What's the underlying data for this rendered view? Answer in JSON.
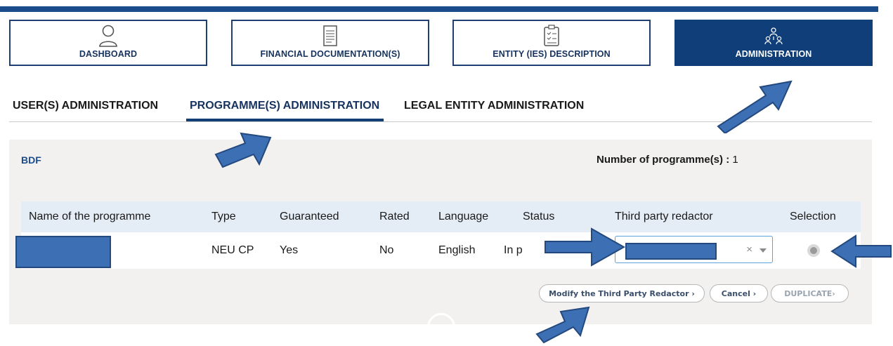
{
  "nav": {
    "cards": [
      {
        "label": "DASHBOARD",
        "icon": "user-icon"
      },
      {
        "label": "FINANCIAL DOCUMENTATION(S)",
        "icon": "document-icon"
      },
      {
        "label": "ENTITY (IES) DESCRIPTION",
        "icon": "clipboard-icon"
      },
      {
        "label": "ADMINISTRATION",
        "icon": "org-chart-icon"
      }
    ],
    "active": "ADMINISTRATION"
  },
  "subtabs": [
    {
      "label": "USER(S) ADMINISTRATION"
    },
    {
      "label": "PROGRAMME(S) ADMINISTRATION"
    },
    {
      "label": "LEGAL ENTITY ADMINISTRATION"
    }
  ],
  "panel": {
    "entity": "BDF",
    "count_label": "Number of programme(s) :",
    "count_value": "1"
  },
  "table": {
    "columns": [
      "Name of the programme",
      "Type",
      "Guaranteed",
      "Rated",
      "Language",
      "Status",
      "Third party redactor",
      "Selection"
    ],
    "rows": [
      {
        "name": "",
        "type": "NEU CP",
        "guaranteed": "Yes",
        "rated": "No",
        "language": "English",
        "status": "In p",
        "third_party_redactor": "",
        "selected": true
      }
    ]
  },
  "actions": {
    "modify": "Modify the Third Party Redactor ›",
    "cancel": "Cancel ›",
    "duplicate": "DUPLICATE›"
  },
  "colors": {
    "brand": "#0f3e78",
    "annotation_arrow": "#3c6fb3"
  }
}
